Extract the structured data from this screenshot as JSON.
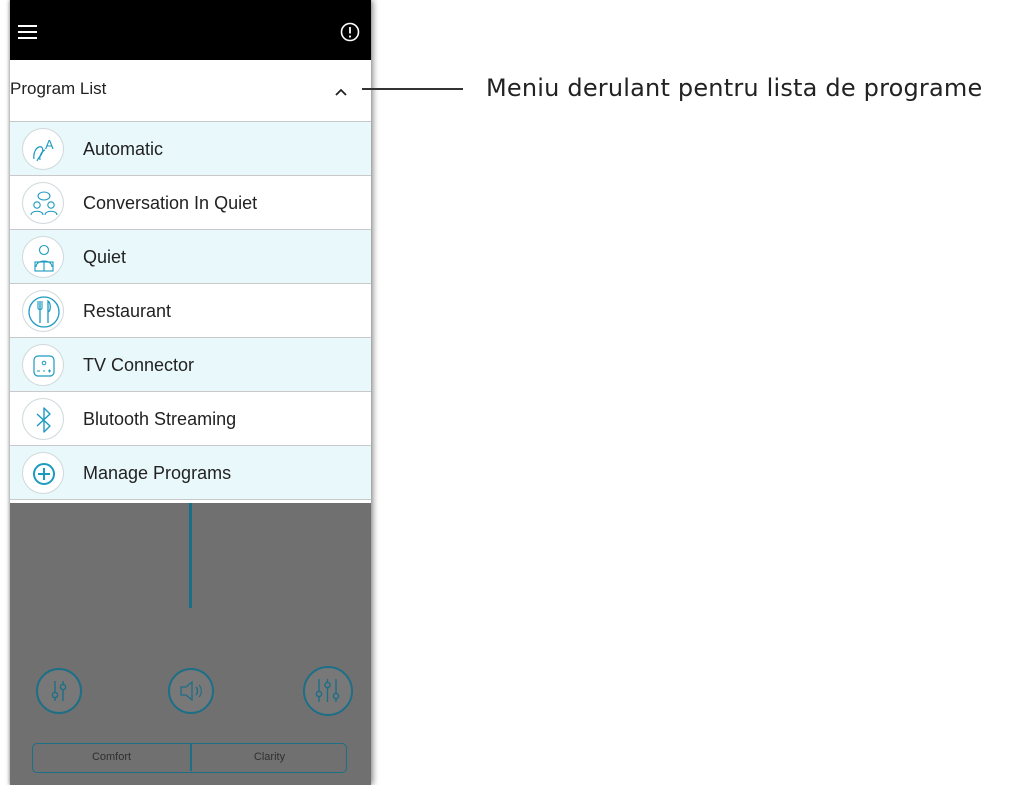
{
  "header": {
    "title": "Program List"
  },
  "programs": [
    {
      "label": "Automatic",
      "icon": "automatic-icon"
    },
    {
      "label": "Conversation In Quiet",
      "icon": "conversation-icon"
    },
    {
      "label": "Quiet",
      "icon": "quiet-icon"
    },
    {
      "label": "Restaurant",
      "icon": "restaurant-icon"
    },
    {
      "label": "TV Connector",
      "icon": "tv-connector-icon"
    },
    {
      "label": "Blutooth Streaming",
      "icon": "bluetooth-icon"
    },
    {
      "label": "Manage Programs",
      "icon": "plus-circle-icon"
    }
  ],
  "segment": {
    "left": "Comfort",
    "right": "Clarity"
  },
  "callout": {
    "text": "Meniu derulant pentru lista de programe"
  },
  "colors": {
    "accent": "#1c9ac0",
    "row_alt": "#e9f8fb",
    "topbar": "#000000",
    "overlay": "#707070"
  }
}
